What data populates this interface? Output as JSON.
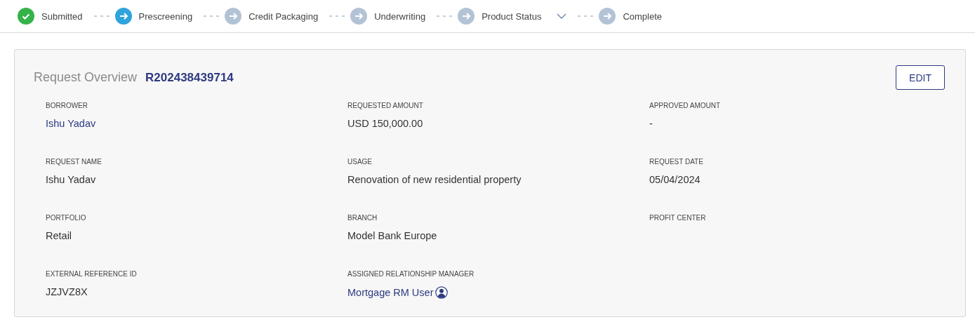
{
  "steps": [
    {
      "label": "Submitted",
      "completed": true,
      "selected": false,
      "has_menu": false
    },
    {
      "label": "Prescreening",
      "completed": false,
      "selected": true,
      "has_menu": false
    },
    {
      "label": "Credit Packaging",
      "completed": false,
      "selected": false,
      "has_menu": false
    },
    {
      "label": "Underwriting",
      "completed": false,
      "selected": false,
      "has_menu": false
    },
    {
      "label": "Product Status",
      "completed": false,
      "selected": false,
      "has_menu": true
    },
    {
      "label": "Complete",
      "completed": false,
      "selected": false,
      "has_menu": false
    }
  ],
  "overview": {
    "title": "Request Overview",
    "request_id": "R202438439714",
    "edit_button": "EDIT",
    "rows": [
      [
        {
          "label": "BORROWER",
          "value": "Ishu Yadav",
          "kind": "link"
        },
        {
          "label": "REQUESTED AMOUNT",
          "value": "USD 150,000.00",
          "kind": "text"
        },
        {
          "label": "APPROVED AMOUNT",
          "value": "-",
          "kind": "text"
        }
      ],
      [
        {
          "label": "REQUEST NAME",
          "value": "Ishu Yadav",
          "kind": "text"
        },
        {
          "label": "USAGE",
          "value": "Renovation of new residential property",
          "kind": "text"
        },
        {
          "label": "REQUEST DATE",
          "value": "05/04/2024",
          "kind": "text"
        }
      ],
      [
        {
          "label": "PORTFOLIO",
          "value": "Retail",
          "kind": "text"
        },
        {
          "label": "BRANCH",
          "value": "Model Bank Europe",
          "kind": "text"
        },
        {
          "label": "PROFIT CENTER",
          "kind": "empty"
        }
      ],
      [
        {
          "label": "EXTERNAL REFERENCE ID",
          "value": "JZJVZ8X",
          "kind": "text"
        },
        {
          "label": "ASSIGNED RELATIONSHIP MANAGER",
          "value": "Mortgage RM User",
          "kind": "person"
        }
      ]
    ]
  }
}
